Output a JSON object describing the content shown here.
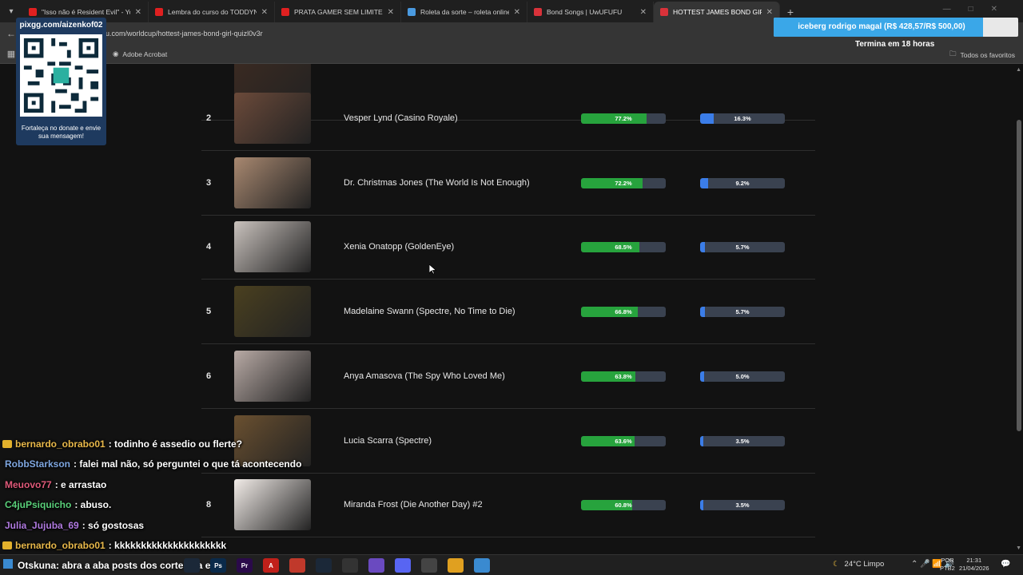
{
  "browser": {
    "tabs": [
      {
        "title": "\"Isso não é Resident Evil\" - You",
        "color": "#e02020",
        "active": false
      },
      {
        "title": "Lembra do curso do TODDYNT",
        "color": "#e02020",
        "active": false
      },
      {
        "title": "PRATA GAMER SEM LIMITES - Y",
        "color": "#e02020",
        "active": false
      },
      {
        "title": "Roleta da sorte – roleta online",
        "color": "#4a9ae0",
        "active": false
      },
      {
        "title": "Bond Songs | UwUFUFU",
        "color": "#d9323a",
        "active": false
      },
      {
        "title": "HOTTEST JAMES BOND GIRL | U",
        "color": "#d9323a",
        "active": true
      }
    ],
    "new_tab": "+",
    "url": "u.com/worldcup/hottest-james-bond-girl-quizl0v3r",
    "bookmarks": {
      "acrobat": "Adobe Acrobat",
      "favorites": "Todos os favoritos"
    }
  },
  "ranking": [
    {
      "rank": "",
      "name": "",
      "win": null,
      "champ": null,
      "thumb": "#3a2a22"
    },
    {
      "rank": "2",
      "name": "Vesper Lynd (Casino Royale)",
      "win": 77.2,
      "win_label": "77.2%",
      "champ": 16.3,
      "champ_label": "16.3%",
      "thumb": "#6b4a3a"
    },
    {
      "rank": "3",
      "name": "Dr. Christmas Jones (The World Is Not Enough)",
      "win": 72.2,
      "win_label": "72.2%",
      "champ": 9.2,
      "champ_label": "9.2%",
      "thumb": "#a88870"
    },
    {
      "rank": "4",
      "name": "Xenia Onatopp (GoldenEye)",
      "win": 68.5,
      "win_label": "68.5%",
      "champ": 5.7,
      "champ_label": "5.7%",
      "thumb": "#c9c2bd"
    },
    {
      "rank": "5",
      "name": "Madelaine Swann (Spectre, No Time to Die)",
      "win": 66.8,
      "win_label": "66.8%",
      "champ": 5.7,
      "champ_label": "5.7%",
      "thumb": "#4a4020"
    },
    {
      "rank": "6",
      "name": "Anya Amasova (The Spy Who Loved Me)",
      "win": 63.8,
      "win_label": "63.8%",
      "champ": 5.0,
      "champ_label": "5.0%",
      "thumb": "#b8aaa5"
    },
    {
      "rank": "",
      "name": "Lucia Scarra (Spectre)",
      "win": 63.6,
      "win_label": "63.6%",
      "champ": 3.5,
      "champ_label": "3.5%",
      "thumb": "#6a5030"
    },
    {
      "rank": "8",
      "name": "Miranda Frost (Die Another Day) #2",
      "win": 60.8,
      "win_label": "60.8%",
      "champ": 3.5,
      "champ_label": "3.5%",
      "thumb": "#f2ece8"
    }
  ],
  "overlay": {
    "qr_url": "pixgg.com/aizenkof02",
    "qr_note": "Fortaleça no donate e envie sua mensagem!",
    "goal_text": "iceberg rodrigo magal (R$ 428,57/R$ 500,00)",
    "goal_progress": 0.857,
    "goal_time": "Termina em 18 horas"
  },
  "chat": [
    {
      "user": "bernardo_obrabo01",
      "badge": true,
      "color": "#e8b84a",
      "text": ": todinho é assedio ou flerte?"
    },
    {
      "user": "RobbStarkson",
      "badge": false,
      "color": "#7fa7e0",
      "text": ": falei mal não, só perguntei o que tá acontecendo"
    },
    {
      "user": "Meuovo77",
      "badge": false,
      "color": "#e05a7a",
      "text": ": e arrastao"
    },
    {
      "user": "C4juPsiquicho",
      "badge": false,
      "color": "#5ad07a",
      "text": ": abuso."
    },
    {
      "user": "Julia_Jujuba_69",
      "badge": false,
      "color": "#b07ae0",
      "text": ": só gostosas"
    },
    {
      "user": "bernardo_obrabo01",
      "badge": true,
      "color": "#e8b84a",
      "text": ": kkkkkkkkkkkkkkkkkkkkk"
    }
  ],
  "taskbar": {
    "marquee": "Otskuna: abra a aba posts dos cortes da end",
    "weather": "24°C  Limpo",
    "lang": [
      "POR",
      "PTB2"
    ],
    "time": "21:31",
    "date": "21/04/2026",
    "apps": [
      {
        "name": "steam-app-icon",
        "label": "",
        "color": "#1b2838"
      },
      {
        "name": "photoshop-app-icon",
        "label": "Ps",
        "color": "#0a2a4a"
      },
      {
        "name": "premiere-app-icon",
        "label": "Pr",
        "color": "#2a0a4a"
      },
      {
        "name": "acrobat-app-icon",
        "label": "A",
        "color": "#c0201a"
      },
      {
        "name": "grid-app-icon",
        "label": "",
        "color": "#c0392b"
      },
      {
        "name": "steam2-app-icon",
        "label": "",
        "color": "#1b2838"
      },
      {
        "name": "obs-app-icon",
        "label": "",
        "color": "#333"
      },
      {
        "name": "crystal-app-icon",
        "label": "",
        "color": "#6a4ac0"
      },
      {
        "name": "discord-app-icon",
        "label": "",
        "color": "#5865f2"
      },
      {
        "name": "obs2-app-icon",
        "label": "",
        "color": "#444"
      },
      {
        "name": "chrome-app-icon",
        "label": "",
        "color": "#e0a020"
      },
      {
        "name": "app-icon",
        "label": "",
        "color": "#3a8ad0"
      }
    ]
  }
}
